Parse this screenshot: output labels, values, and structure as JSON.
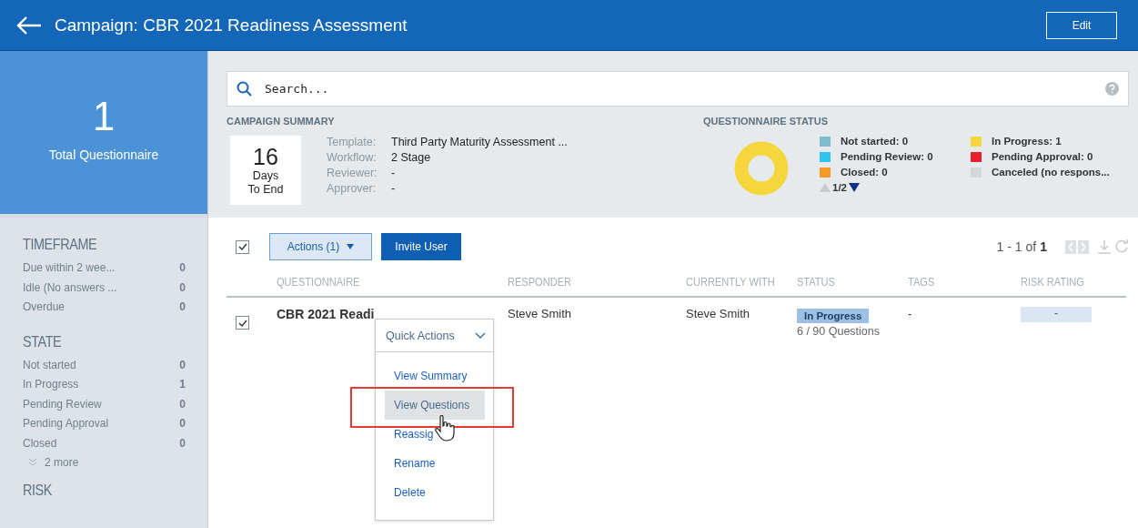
{
  "header": {
    "title": "Campaign: CBR 2021 Readiness Assessment",
    "edit_button": "Edit"
  },
  "total": {
    "value": "1",
    "label": "Total Questionnaire"
  },
  "sidebar": [
    {
      "title": "TIMEFRAME",
      "items": [
        {
          "label": "Due within 2 wee...",
          "count": "0"
        },
        {
          "label": "Idle (No answers ...",
          "count": "0"
        },
        {
          "label": "Overdue",
          "count": "0"
        }
      ]
    },
    {
      "title": "STATE",
      "items": [
        {
          "label": "Not started",
          "count": "0"
        },
        {
          "label": "In Progress",
          "count": "1"
        },
        {
          "label": "Pending Review",
          "count": "0"
        },
        {
          "label": "Pending Approval",
          "count": "0"
        },
        {
          "label": "Closed",
          "count": "0"
        }
      ],
      "more": "2 more"
    },
    {
      "title": "RISK"
    }
  ],
  "search": {
    "placeholder": "Search..."
  },
  "summary": {
    "title": "CAMPAIGN SUMMARY",
    "days": "16",
    "days_label": "Days",
    "days_label2": "To End",
    "fields": [
      {
        "label": "Template:",
        "value": "Third Party Maturity Assessment ..."
      },
      {
        "label": "Workflow:",
        "value": "2 Stage"
      },
      {
        "label": "Reviewer:",
        "value": "-"
      },
      {
        "label": "Approver:",
        "value": "-"
      }
    ]
  },
  "status": {
    "title": "QUESTIONNAIRE STATUS",
    "legend": [
      {
        "label": "Not started: 0",
        "color": "#7fbccb"
      },
      {
        "label": "In Progress: 1",
        "color": "#f5d63d"
      },
      {
        "label": "Pending Review: 0",
        "color": "#2ec4f0"
      },
      {
        "label": "Pending Approval: 0",
        "color": "#e8212e"
      },
      {
        "label": "Closed: 0",
        "color": "#f59a23"
      },
      {
        "label": "Canceled (no respons...",
        "color": "#d4d6d8"
      }
    ],
    "page": "1/2"
  },
  "toolbar": {
    "select_all_checked": true,
    "actions": "Actions (1)",
    "invite": "Invite User",
    "range": "1 - 1 of",
    "total": "1"
  },
  "table": {
    "columns": [
      "QUESTIONNAIRE",
      "RESPONDER",
      "CURRENTLY WITH",
      "STATUS",
      "TAGS",
      "RISK RATING"
    ],
    "rows": [
      {
        "checked": true,
        "name": "CBR 2021 Readi",
        "responder": "Steve Smith",
        "currently_with": "Steve Smith",
        "status": "In Progress",
        "progress": "6 / 90 Questions",
        "tags": "-",
        "risk": "-"
      }
    ]
  },
  "quick_actions": {
    "title": "Quick Actions",
    "items": [
      {
        "label": "View Summary",
        "selected": false
      },
      {
        "label": "View Questions",
        "selected": true
      },
      {
        "label": "Reassig",
        "selected": false
      },
      {
        "label": "Rename",
        "selected": false
      },
      {
        "label": "Delete",
        "selected": false
      }
    ]
  }
}
